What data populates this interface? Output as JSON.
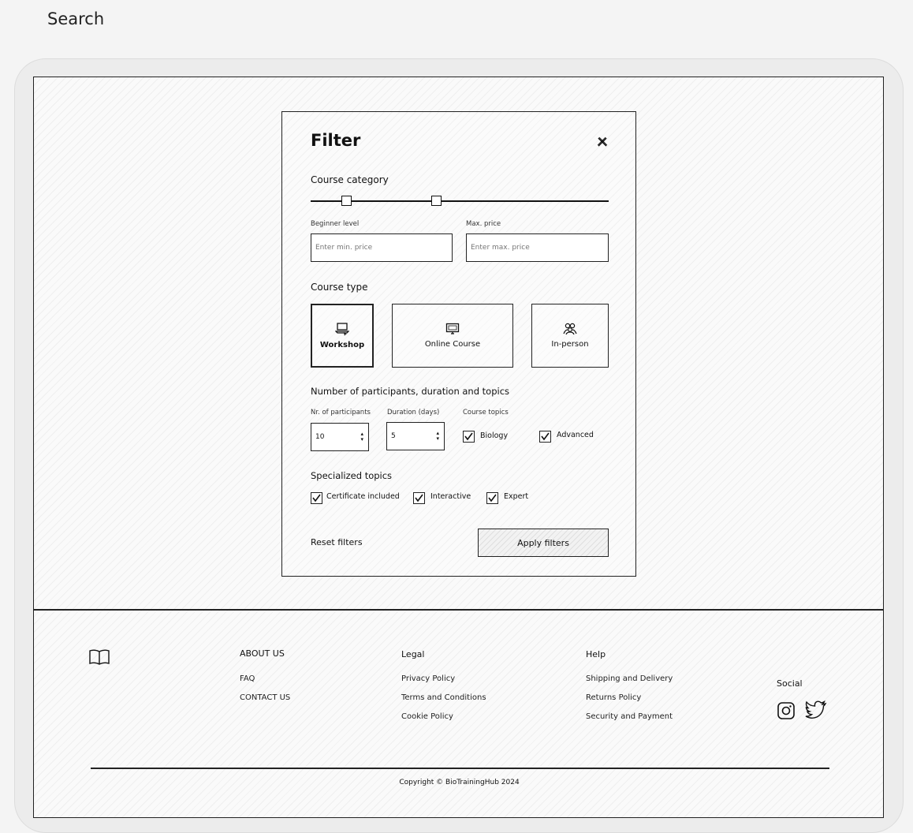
{
  "page": {
    "title": "Search"
  },
  "filter": {
    "title": "Filter",
    "course_category_label": "Course category",
    "slider": {
      "min_fraction": 0.12,
      "max_fraction": 0.42
    },
    "min_price_label": "Beginner level",
    "min_price_placeholder": "Enter min. price",
    "max_price_label": "Max. price",
    "max_price_placeholder": "Enter max. price",
    "course_type_label": "Course type",
    "course_types": [
      {
        "label": "Workshop",
        "icon": "laptop-cursor-icon",
        "selected": true
      },
      {
        "label": "Online Course",
        "icon": "monitor-icon",
        "selected": false
      },
      {
        "label": "In-person",
        "icon": "people-icon",
        "selected": false
      }
    ],
    "participants_section_label": "Number of participants, duration and topics",
    "participants_label": "Nr. of participants",
    "participants_value": "10",
    "duration_label": "Duration (days)",
    "duration_value": "5",
    "course_topics_label": "Course topics",
    "course_topics": [
      {
        "label": "Biology",
        "checked": true
      },
      {
        "label": "Advanced",
        "checked": true
      }
    ],
    "specialized_label": "Specialized topics",
    "specialized_topics": [
      {
        "label": "Certificate included",
        "checked": true
      },
      {
        "label": "Interactive",
        "checked": true
      },
      {
        "label": "Expert",
        "checked": true
      }
    ],
    "reset_label": "Reset filters",
    "apply_label": "Apply filters"
  },
  "footer": {
    "logo_icon": "open-book-icon",
    "about": {
      "title": "ABOUT US",
      "links": [
        "FAQ",
        "CONTACT US"
      ]
    },
    "legal": {
      "title": "Legal",
      "links": [
        "Privacy Policy",
        "Terms and Conditions",
        "Cookie Policy"
      ]
    },
    "help": {
      "title": "Help",
      "links": [
        "Shipping and Delivery",
        "Returns Policy",
        "Security and Payment"
      ]
    },
    "social": {
      "title": "Social",
      "icons": [
        "instagram-icon",
        "twitter-icon"
      ]
    },
    "copyright": "Copyright © BioTrainingHub 2024"
  }
}
